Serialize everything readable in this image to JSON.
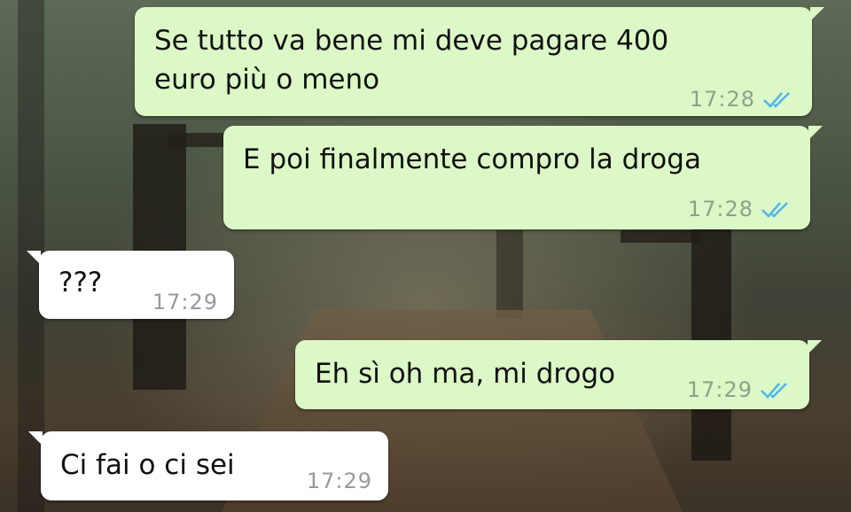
{
  "messages": [
    {
      "direction": "outgoing",
      "text": "Se tutto va bene mi deve pagare 400\neuro più o meno",
      "time": "17:28",
      "status_icon": "double-check-read-icon"
    },
    {
      "direction": "outgoing",
      "text": "E poi finalmente compro la droga",
      "time": "17:28",
      "status_icon": "double-check-read-icon"
    },
    {
      "direction": "incoming",
      "text": "???",
      "time": "17:29"
    },
    {
      "direction": "outgoing",
      "text": "Eh sì oh ma, mi drogo",
      "time": "17:29",
      "status_icon": "double-check-read-icon"
    },
    {
      "direction": "incoming",
      "text": "Ci fai o ci sei",
      "time": "17:29"
    }
  ],
  "colors": {
    "outgoing_bubble": "#dcf8c6",
    "incoming_bubble": "#ffffff",
    "read_ticks": "#4fb6ec"
  }
}
